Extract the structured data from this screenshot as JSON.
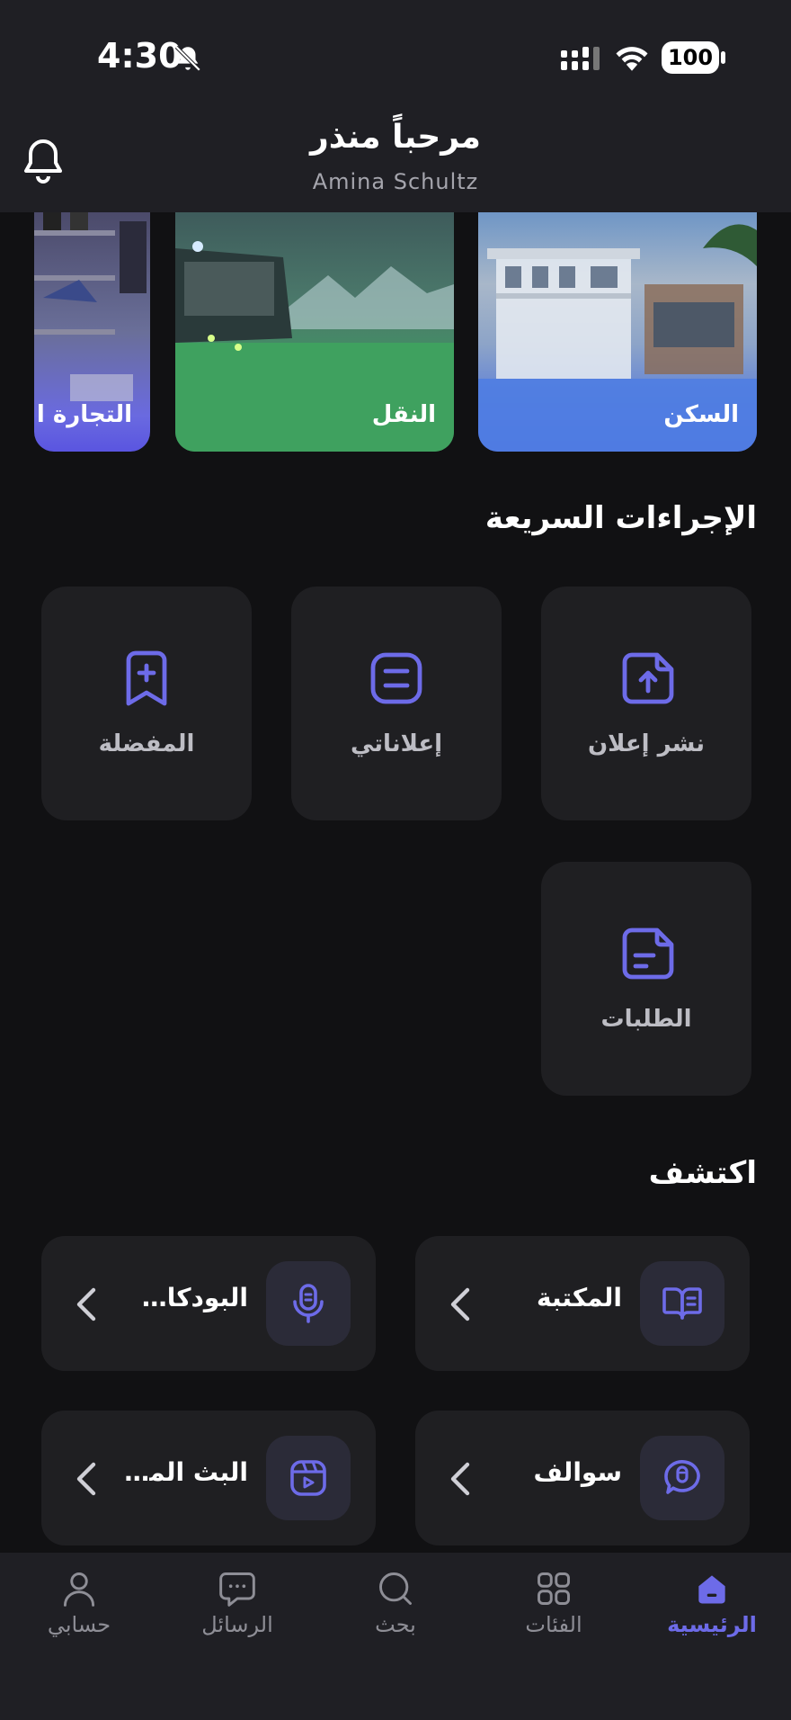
{
  "status_bar": {
    "time": "4:30",
    "battery": "100"
  },
  "header": {
    "greeting": "مرحباً منذر",
    "username": "Amina Schultz"
  },
  "categories": [
    {
      "label": "السكن"
    },
    {
      "label": "النقل"
    },
    {
      "label": "التجارة ا"
    }
  ],
  "quick_actions": {
    "title": "الإجراءات السريعة",
    "items": [
      {
        "label": "نشر إعلان",
        "icon": "upload-file-icon"
      },
      {
        "label": "إعلاناتي",
        "icon": "list-icon"
      },
      {
        "label": "المفضلة",
        "icon": "bookmark-add-icon"
      },
      {
        "label": "الطلبات",
        "icon": "document-icon"
      }
    ]
  },
  "discover": {
    "title": "اكتشف",
    "items": [
      {
        "label": "المكتبة",
        "icon": "book-icon"
      },
      {
        "label": "البودكاس...",
        "icon": "microphone-icon"
      },
      {
        "label": "سوالف",
        "icon": "chat-mic-icon"
      },
      {
        "label": "البث المب...",
        "icon": "live-video-icon"
      }
    ]
  },
  "tabbar": {
    "items": [
      {
        "label": "الرئيسية",
        "icon": "home-icon",
        "active": true
      },
      {
        "label": "الفئات",
        "icon": "grid-icon"
      },
      {
        "label": "بحث",
        "icon": "search-icon"
      },
      {
        "label": "الرسائل",
        "icon": "message-icon"
      },
      {
        "label": "حسابي",
        "icon": "user-icon"
      }
    ]
  },
  "colors": {
    "accent": "#6d6be8",
    "card": "#1f1f22",
    "background": "#111113"
  }
}
